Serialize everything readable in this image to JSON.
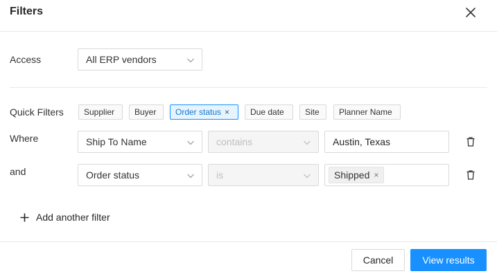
{
  "dialog": {
    "title": "Filters"
  },
  "access": {
    "label": "Access",
    "value": "All ERP vendors"
  },
  "quick_filters": {
    "label": "Quick Filters",
    "chips": [
      {
        "label": "Supplier",
        "active": false
      },
      {
        "label": "Buyer",
        "active": false
      },
      {
        "label": "Order status",
        "active": true,
        "remove": "×"
      },
      {
        "label": "Due date",
        "active": false
      },
      {
        "label": "Site",
        "active": false
      },
      {
        "label": "Planner Name",
        "active": false
      }
    ]
  },
  "filters": [
    {
      "connector": "Where",
      "field": "Ship To Name",
      "operator": "contains",
      "value": "Austin, Texas"
    },
    {
      "connector": "and",
      "field": "Order status",
      "operator": "is",
      "tag": "Shipped",
      "tag_remove": "×"
    }
  ],
  "add_filter": {
    "label": "Add another filter"
  },
  "footer": {
    "cancel_label": "Cancel",
    "submit_label": "View results"
  },
  "colors": {
    "primary": "#1890ff",
    "chip_active_bg": "#e6f4ff",
    "border": "#d9d9d9",
    "disabled_bg": "#f5f5f5"
  },
  "icons": [
    "close-icon",
    "chevron-down-icon",
    "trash-icon",
    "plus-icon"
  ]
}
